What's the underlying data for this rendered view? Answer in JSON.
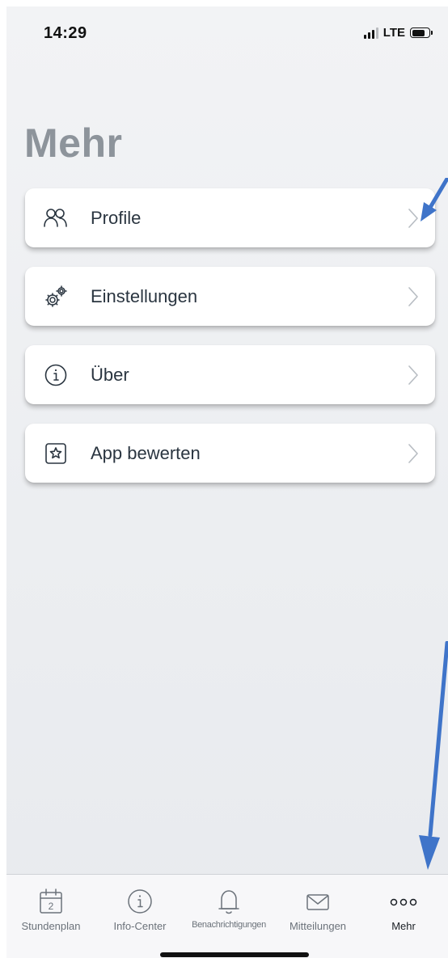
{
  "status_bar": {
    "time": "14:29",
    "network": "LTE",
    "signal_bars_active": 3,
    "signal_bars_total": 4,
    "battery_level": 0.8
  },
  "page": {
    "title": "Mehr"
  },
  "menu": {
    "items": [
      {
        "label": "Profile",
        "icon": "profiles-icon"
      },
      {
        "label": "Einstellungen",
        "icon": "settings-gears-icon"
      },
      {
        "label": "Über",
        "icon": "info-icon"
      },
      {
        "label": "App bewerten",
        "icon": "star-rating-icon"
      }
    ]
  },
  "tab_bar": {
    "active": "Mehr",
    "calendar_day": "2",
    "tabs": [
      {
        "label": "Stundenplan",
        "icon": "calendar-icon"
      },
      {
        "label": "Info-Center",
        "icon": "info-icon"
      },
      {
        "label": "Benachrichtigungen",
        "icon": "bell-icon"
      },
      {
        "label": "Mitteilungen",
        "icon": "mail-icon"
      },
      {
        "label": "Mehr",
        "icon": "more-dots-icon"
      }
    ]
  },
  "colors": {
    "title": "#8d949b",
    "annotation_arrow": "#3f74c9",
    "text": "#2a3540",
    "tab_inactive": "#6b727a"
  }
}
